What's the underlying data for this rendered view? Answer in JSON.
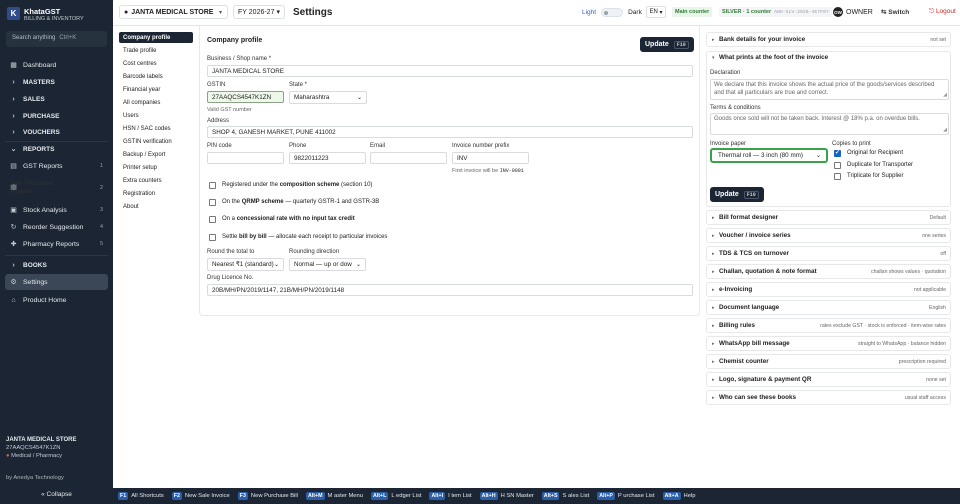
{
  "sidebar": {
    "brand": {
      "title": "KhataGST",
      "subtitle": "BILLING & INVENTORY",
      "logo": "K"
    },
    "search": {
      "placeholder": "Search anything",
      "shortcut": "Ctrl+K"
    },
    "items": [
      {
        "label": "Dashboard",
        "icon": "grid-icon"
      },
      {
        "label": "MASTERS",
        "icon": "chevron-right-icon"
      },
      {
        "label": "SALES",
        "icon": "chevron-right-icon"
      },
      {
        "label": "PURCHASE",
        "icon": "chevron-right-icon"
      },
      {
        "label": "VOUCHERS",
        "icon": "chevron-right-icon"
      },
      {
        "label": "REPORTS",
        "icon": "chevron-down-icon"
      },
      {
        "label": "GST Reports",
        "count": "1"
      },
      {
        "label": "Sale / Purchase Analysis",
        "count": "2"
      },
      {
        "label": "Stock Analysis",
        "count": "3"
      },
      {
        "label": "Reorder Suggestion",
        "count": "4"
      },
      {
        "label": "Pharmacy Reports",
        "count": "5"
      },
      {
        "label": "BOOKS",
        "icon": "chevron-right-icon"
      },
      {
        "label": "Settings",
        "icon": "gear-icon"
      },
      {
        "label": "Product Home",
        "icon": "home-icon"
      }
    ],
    "footer": {
      "store": "JANTA MEDICAL STORE",
      "gstin": "27AAQCS4547K1ZN",
      "type": "Medical / Pharmacy",
      "by": "by Anedya Technology",
      "collapse": "« Collapse"
    }
  },
  "header": {
    "store": "JANTA MEDICAL STORE",
    "fy": "FY 2026-27",
    "title": "Settings",
    "theme_light": "Light",
    "theme_dark": "Dark",
    "lang": "EN",
    "main_counter": "Main counter",
    "plan": "SILVER · 1 counter",
    "plan_id": "ANO-SLV-2026-4E7F07",
    "avatar": "OW",
    "role": "OWNER",
    "switch": "⇆ Switch",
    "logout": "⎋ Logout"
  },
  "settings_nav": [
    "Company profile",
    "Trade profile",
    "Cost centres",
    "Barcode labels",
    "Financial year",
    "All companies",
    "Users",
    "HSN / SAC codes",
    "GSTIN verification",
    "Backup / Export",
    "Printer setup",
    "Extra counters",
    "Registration",
    "About"
  ],
  "company": {
    "heading": "Company profile",
    "update_label": "Update",
    "update_key": "F10",
    "business_label": "Business / Shop name *",
    "business_value": "JANTA MEDICAL STORE",
    "gstin_label": "GSTIN",
    "gstin_value": "27AAQCS4547K1ZN",
    "gstin_status": "Valid GST number",
    "state_label": "State *",
    "state_value": "Maharashtra",
    "address_label": "Address",
    "address_value": "SHOP 4, GANESH MARKET, PUNE 411002",
    "pin_label": "PIN code",
    "pin_value": "",
    "phone_label": "Phone",
    "phone_value": "9822011223",
    "email_label": "Email",
    "email_value": "",
    "prefix_label": "Invoice number prefix",
    "prefix_value": "INV",
    "prefix_note": "First invoice will be",
    "prefix_example": "INV-0001",
    "checks": [
      {
        "pre": "Registered under the ",
        "bold": "composition scheme",
        "post": " (section 10)"
      },
      {
        "pre": "On the ",
        "bold": "QRMP scheme",
        "post": " — quarterly GSTR-1 and GSTR-3B"
      },
      {
        "pre": "On a ",
        "bold": "concessional rate with no input tax credit",
        "post": ""
      },
      {
        "pre": "Settle ",
        "bold": "bill by bill",
        "post": " — allocate each receipt to particular invoices"
      }
    ],
    "round_label": "Round the total to",
    "round_value": "Nearest ₹1 (standard)",
    "rounding_dir_label": "Rounding direction",
    "rounding_dir_value": "Normal — up or dow",
    "drug_label": "Drug Licence No.",
    "drug_value": "20B/MH/PN/2019/1147, 21B/MH/PN/2019/1148"
  },
  "right": {
    "bank": {
      "title": "Bank details for your invoice",
      "value": "not set"
    },
    "foot": {
      "title": "What prints at the foot of the invoice",
      "declaration_label": "Declaration",
      "declaration_value": "We declare that this invoice shows the actual price of the goods/services described and that all particulars are true and correct.",
      "terms_label": "Terms & conditions",
      "terms_value": "Goods once sold will not be taken back. Interest @ 18% p.a. on overdue bills.",
      "paper_label": "Invoice paper",
      "paper_value": "Thermal roll — 3 inch (80 mm)",
      "copies_label": "Copies to print",
      "copies": [
        {
          "label": "Original for Recipient",
          "checked": true
        },
        {
          "label": "Duplicate for Transporter",
          "checked": false
        },
        {
          "label": "Triplicate for Supplier",
          "checked": false
        }
      ],
      "update_label": "Update",
      "update_key": "F10"
    },
    "sections": [
      {
        "title": "Bill format designer",
        "value": "Default"
      },
      {
        "title": "Voucher / invoice series",
        "value": "one series"
      },
      {
        "title": "TDS & TCS on turnover",
        "value": "off"
      },
      {
        "title": "Challan, quotation & note format",
        "value": "challan shows values · quotation"
      },
      {
        "title": "e-Invoicing",
        "value": "not applicable"
      },
      {
        "title": "Document language",
        "value": "English"
      },
      {
        "title": "Billing rules",
        "value": "rates exclude GST · stock is enforced · item-wise rates"
      },
      {
        "title": "WhatsApp bill message",
        "value": "straight to WhatsApp · balance hidden"
      },
      {
        "title": "Chemist counter",
        "value": "prescription required"
      },
      {
        "title": "Logo, signature & payment QR",
        "value": "none set"
      },
      {
        "title": "Who can see these books",
        "value": "usual staff access"
      }
    ]
  },
  "footer": [
    {
      "key": "F1",
      "label": "All Shortcuts"
    },
    {
      "key": "F2",
      "label": "New Sale Invoice"
    },
    {
      "key": "F3",
      "label": "New Purchase Bill"
    },
    {
      "key": "Alt+M",
      "label": "M aster Menu"
    },
    {
      "key": "Alt+L",
      "label": "L edger List"
    },
    {
      "key": "Alt+I",
      "label": "I tem List"
    },
    {
      "key": "Alt+H",
      "label": "H SN Master"
    },
    {
      "key": "Alt+S",
      "label": "S ales List"
    },
    {
      "key": "Alt+P",
      "label": "P urchase List"
    },
    {
      "key": "Alt+A",
      "label": "Help"
    }
  ],
  "colors": {
    "sidebar": "#1b2533",
    "accent_green": "#2e7d32",
    "link_blue": "#3264c8",
    "logout_red": "#c62828",
    "paper_border": "#3aa24a"
  }
}
